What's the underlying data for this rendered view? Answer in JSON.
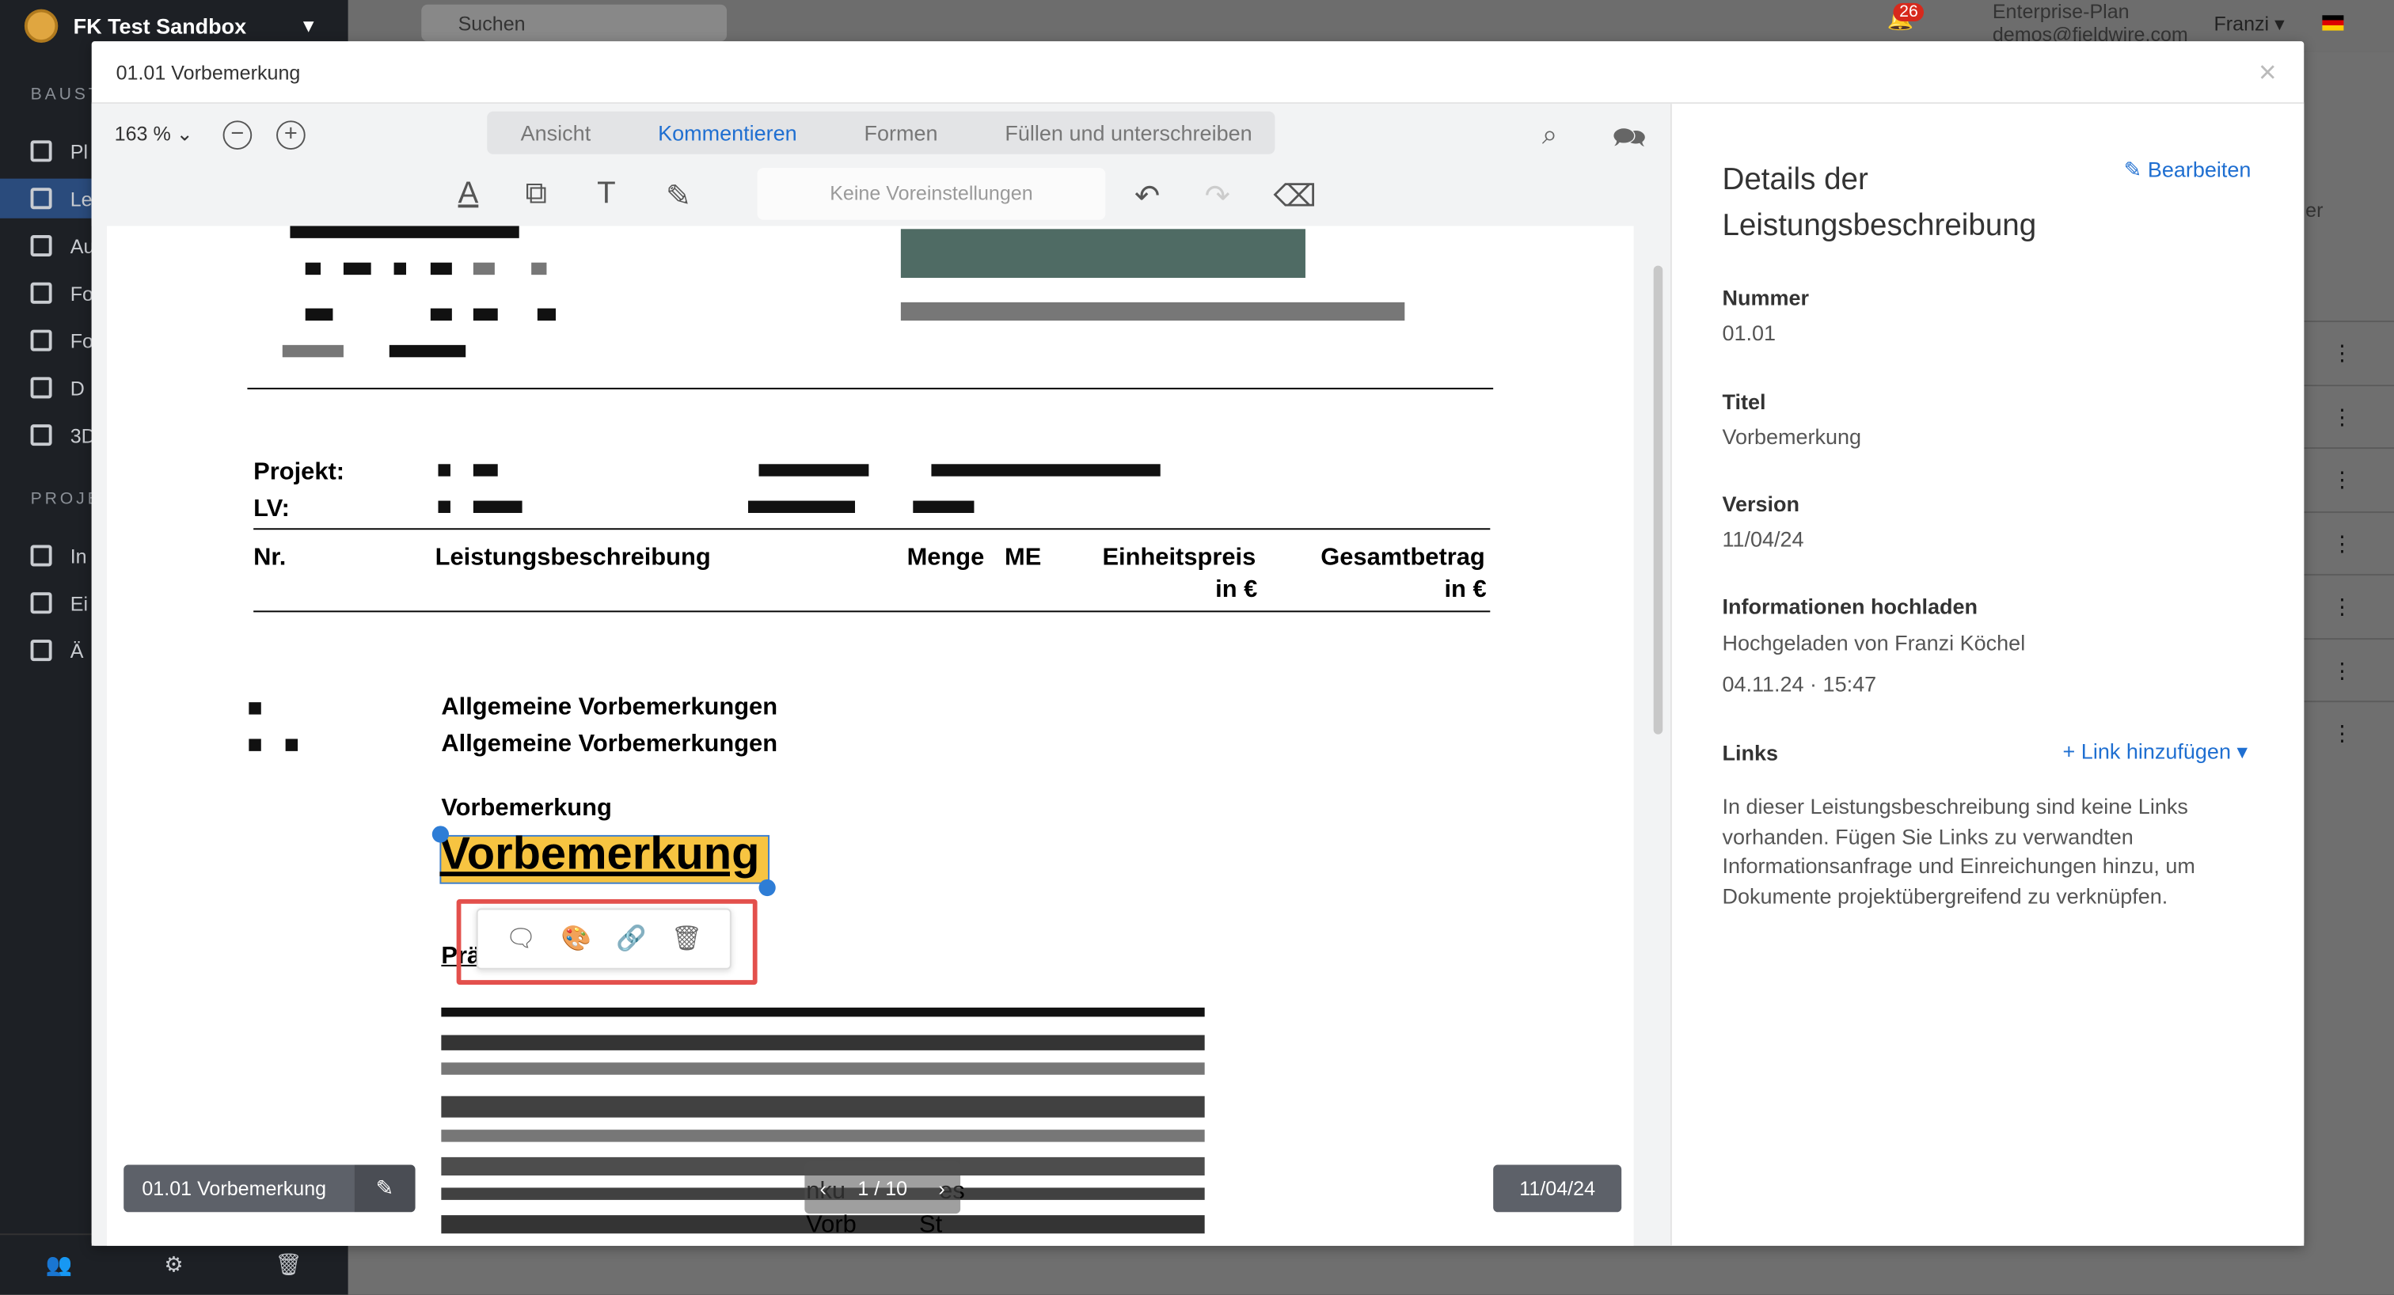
{
  "background": {
    "brand": "FK Test Sandbox",
    "sections": [
      "BAUST",
      "PROJE"
    ],
    "nav_items": [
      "Pl",
      "Le",
      "Au",
      "Fo",
      "Fo",
      "D",
      "3D",
      "In",
      "Ei",
      "Ä"
    ],
    "search_placeholder": "Suchen",
    "notification_count": "26",
    "plan": "Enterprise-Plan",
    "email": "demos@fieldwire.com",
    "user": "Franzi",
    "partial_button": "er"
  },
  "modal": {
    "title": "01.01 Vorbemerkung",
    "close_label": "×"
  },
  "viewer": {
    "zoom": "163 %",
    "tabs": [
      "Ansicht",
      "Kommentieren",
      "Formen",
      "Füllen und unterschreiben"
    ],
    "active_tab": "Kommentieren",
    "preset_placeholder": "Keine Voreinstellungen",
    "page_indicator": "1 / 10",
    "sheet_name": "01.01 Vorbemerkung",
    "version_badge": "11/04/24"
  },
  "document": {
    "project_label": "Projekt:",
    "lv_label": "LV:",
    "col_nr": "Nr.",
    "col_desc": "Leistungsbeschreibung",
    "col_qty": "Menge",
    "col_unit": "ME",
    "col_unit_price_1": "Einheitspreis",
    "col_unit_price_2": "in €",
    "col_total_1": "Gesamtbetrag",
    "col_total_2": "in €",
    "heading_1": "Allgemeine Vorbemerkungen",
    "heading_2": "Allgemeine Vorbemerkungen",
    "subheading": "Vorbemerkung",
    "highlighted": "Vorbemerkung",
    "partial_1": "Prä",
    "partial_2": "nku",
    "partial_3": "es",
    "partial_4": "Vorb",
    "partial_5": "St"
  },
  "details": {
    "title": "Details der Leistungsbeschreibung",
    "edit_label": "Bearbeiten",
    "number_label": "Nummer",
    "number_value": "01.01",
    "title_label": "Titel",
    "title_value": "Vorbemerkung",
    "version_label": "Version",
    "version_value": "11/04/24",
    "upload_label": "Informationen hochladen",
    "upload_value": "Hochgeladen von Franzi Köchel",
    "upload_date": "04.11.24 · 15:47",
    "links_label": "Links",
    "add_link": "+ Link hinzufügen",
    "links_text": "In dieser Leistungsbeschreibung sind keine Links vorhanden. Fügen Sie Links zu verwandten Informationsanfrage und Einreichungen hinzu, um Dokumente projektübergreifend zu verknüpfen."
  },
  "colors": {
    "accent": "#1f6fd1",
    "highlight": "#f7c441",
    "callout": "#e3504c"
  }
}
